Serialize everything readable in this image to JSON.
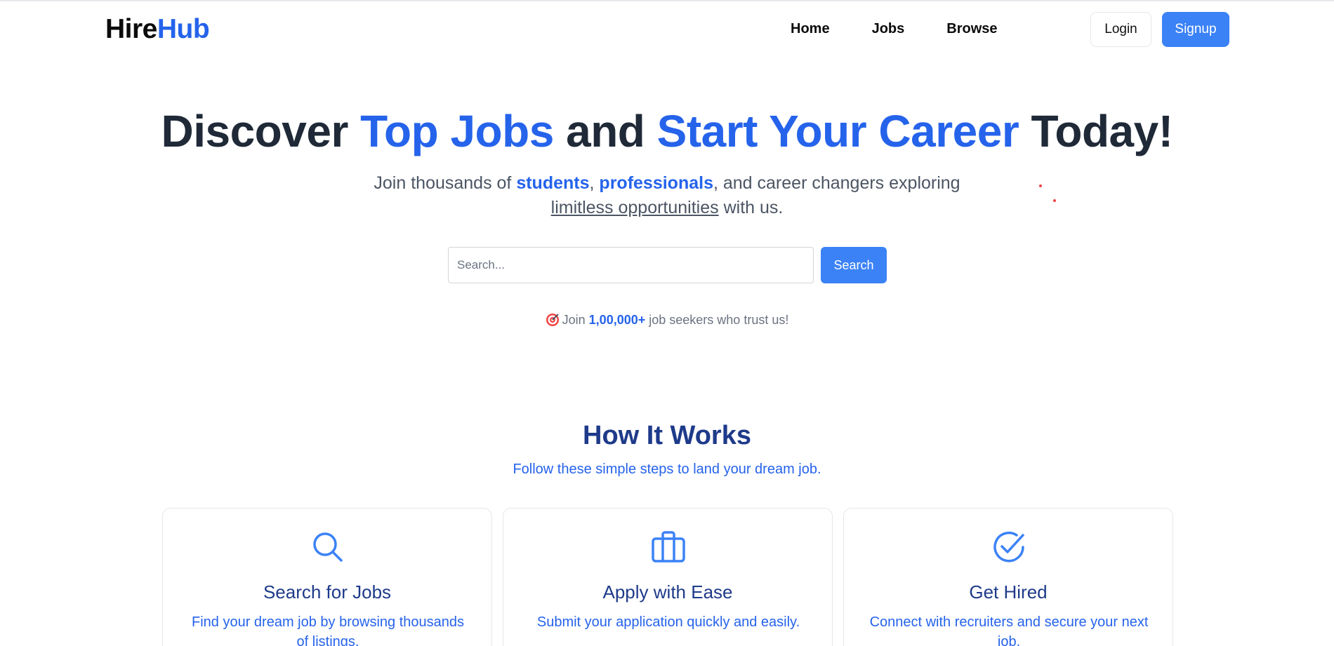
{
  "brand": {
    "part1": "Hire",
    "part2": "Hub"
  },
  "nav": {
    "links": [
      {
        "label": "Home"
      },
      {
        "label": "Jobs"
      },
      {
        "label": "Browse"
      }
    ],
    "login_label": "Login",
    "signup_label": "Signup"
  },
  "hero": {
    "title_1": "Discover ",
    "title_hl_1": "Top Jobs",
    "title_2": " and ",
    "title_hl_2": "Start Your Career",
    "title_3": " Today!",
    "sub_1": "Join thousands of ",
    "sub_students": "students",
    "sub_comma": ", ",
    "sub_professionals": "professionals",
    "sub_2": ", and career changers exploring ",
    "sub_limitless": "limitless opportunities",
    "sub_3": " with us."
  },
  "search": {
    "placeholder": "Search...",
    "button_label": "Search"
  },
  "trust": {
    "pre": "Join ",
    "count": "1,00,000+",
    "post": " job seekers who trust us!"
  },
  "how": {
    "title": "How It Works",
    "subtitle": "Follow these simple steps to land your dream job.",
    "cards": [
      {
        "icon": "search-icon",
        "title": "Search for Jobs",
        "desc": "Find your dream job by browsing thousands of listings."
      },
      {
        "icon": "briefcase-icon",
        "title": "Apply with Ease",
        "desc": "Submit your application quickly and easily."
      },
      {
        "icon": "check-circle-icon",
        "title": "Get Hired",
        "desc": "Connect with recruiters and secure your next job."
      }
    ]
  },
  "colors": {
    "accent": "#2563eb",
    "button": "#3b82f6",
    "heading": "#1f2937",
    "section_heading": "#1e3a8a"
  }
}
